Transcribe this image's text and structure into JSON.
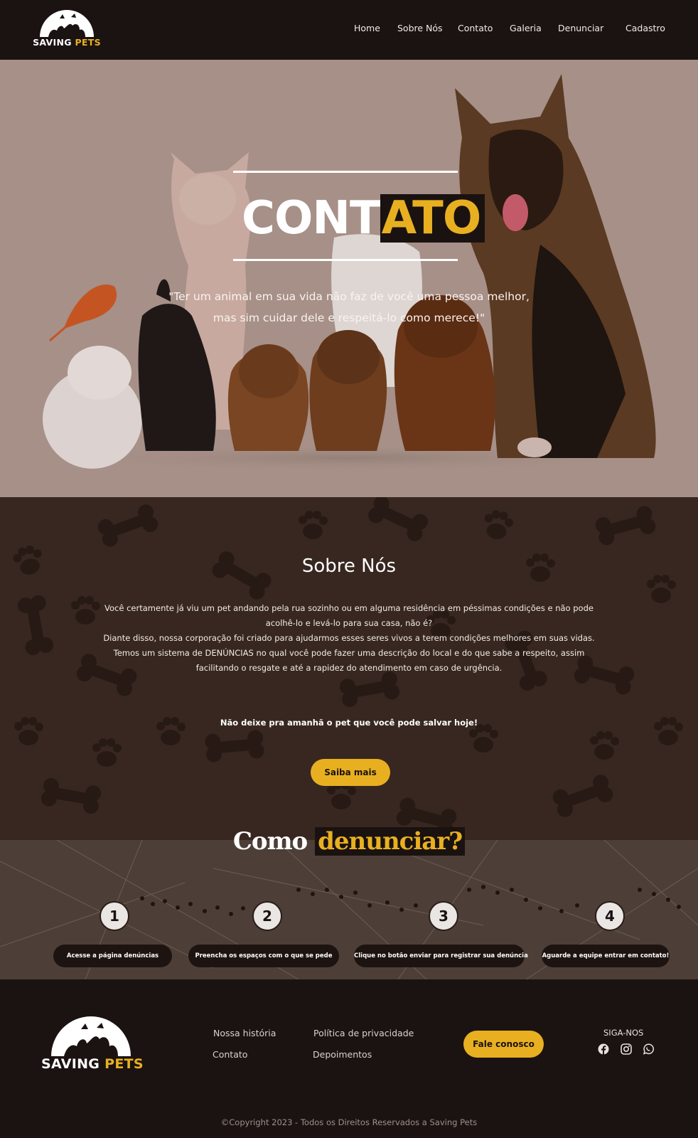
{
  "brand": {
    "name_part1": "SAVING",
    "name_part2": "PETS"
  },
  "nav": {
    "items": [
      {
        "label": "Home"
      },
      {
        "label": "Sobre Nós"
      },
      {
        "label": "Contato"
      },
      {
        "label": "Galeria"
      },
      {
        "label": "Denunciar"
      },
      {
        "label": "Cadastro"
      }
    ]
  },
  "hero": {
    "title_part1": "CONT",
    "title_part2": "ATO",
    "quote_line1": "\"Ter um animal em sua vida não faz de você uma pessoa melhor,",
    "quote_line2": "mas sim cuidar dele e respeitá-lo como merece!\""
  },
  "sobre": {
    "title": "Sobre Nós",
    "lines": [
      "Você certamente já viu um pet andando pela rua sozinho ou em alguma residência em péssimas condições e  não pode",
      "acolhê-lo e levá-lo para sua casa, não é?",
      "Diante disso, nossa corporação foi criado para ajudarmos esses seres vivos a terem condições melhores em suas vidas.",
      "Temos um sistema de DENÚNCIAS no qual você pode fazer uma descrição do local e do que sabe a respeito, assim",
      "facilitando o resgate e até a rapidez do atendimento em caso de urgência."
    ],
    "cta_text": "Não deixe pra amanhã o pet que você pode salvar hoje!",
    "button_label": "Saiba mais"
  },
  "como": {
    "title_part1": "Como",
    "title_part2": "denunciar?",
    "steps": [
      {
        "number": "1",
        "text": "Acesse a página denúncias"
      },
      {
        "number": "2",
        "text": "Preencha os espaços com o que se pede"
      },
      {
        "number": "3",
        "text": "Clique no botão enviar para registrar sua denúncia"
      },
      {
        "number": "4",
        "text": "Aguarde a equipe entrar em contato!"
      }
    ]
  },
  "footer": {
    "links": {
      "historia": "Nossa história",
      "contato": "Contato",
      "privacidade": "Política de privacidade",
      "depoimentos": "Depoimentos"
    },
    "fale_label": "Fale conosco",
    "siga_label": "SIGA-NOS",
    "social_icons": [
      "facebook-icon",
      "instagram-icon",
      "whatsapp-icon"
    ],
    "copyright": "©Copyright 2023 - Todos os Direitos Reservados a Saving Pets"
  },
  "colors": {
    "accent": "#e8b021",
    "dark": "#1b1311",
    "brown": "#382720",
    "hero_bg": "#a69088"
  }
}
